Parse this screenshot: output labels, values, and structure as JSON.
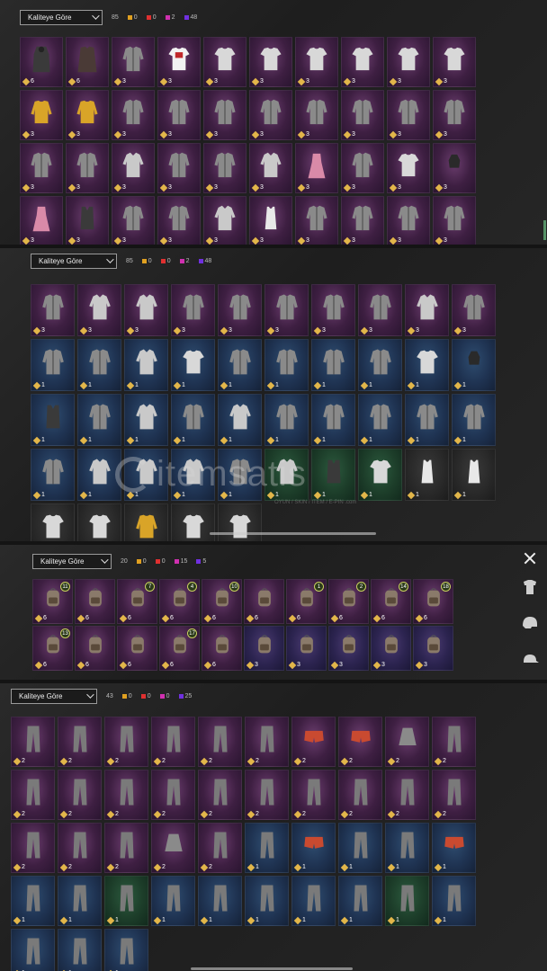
{
  "panels": [
    {
      "id": "p1",
      "sort": "Kaliteye Göre",
      "count": "85",
      "tiers": [
        "0",
        "0",
        "2",
        "48"
      ]
    },
    {
      "id": "p2",
      "sort": "Kaliteye Göre",
      "count": "85",
      "tiers": [
        "0",
        "0",
        "2",
        "48"
      ]
    },
    {
      "id": "p3",
      "sort": "Kaliteye Göre",
      "count": "20",
      "tiers": [
        "0",
        "0",
        "15",
        "5"
      ]
    },
    {
      "id": "p4",
      "sort": "Kaliteye Göre",
      "count": "43",
      "tiers": [
        "0",
        "0",
        "0",
        "25"
      ]
    }
  ],
  "colors": {
    "tier": [
      "#e0a020",
      "#e03030",
      "#d030b0",
      "#7030e0"
    ],
    "legendary": "#6b3d6e",
    "epic": "#4a3a70",
    "rare": "#2f4d70",
    "uncommon": "#2c5a3e"
  },
  "watermark": {
    "brand": "itemsatis",
    "sub": "OYUN / SKIN / İTEM / E-PIN .com"
  },
  "grids": {
    "p1": {
      "rarity": "leg",
      "rows": [
        [
          [
            "robe",
            "6"
          ],
          [
            "coat",
            "6"
          ],
          [
            "jacket",
            "3"
          ],
          [
            "tshirt-kfc",
            "3"
          ],
          [
            "tshirt",
            "3"
          ],
          [
            "tshirt",
            "3"
          ],
          [
            "tshirt",
            "3"
          ],
          [
            "tshirt",
            "3"
          ],
          [
            "tshirt",
            "3"
          ],
          [
            "tshirt",
            "3"
          ]
        ],
        [
          [
            "sweater",
            "3"
          ],
          [
            "sweater",
            "3"
          ],
          [
            "jacket",
            "3"
          ],
          [
            "jacket",
            "3"
          ],
          [
            "jacket",
            "3"
          ],
          [
            "jacket",
            "3"
          ],
          [
            "jacket",
            "3"
          ],
          [
            "jacket",
            "3"
          ],
          [
            "jacket",
            "3"
          ],
          [
            "jacket",
            "3"
          ]
        ],
        [
          [
            "jacket",
            "3"
          ],
          [
            "jacket",
            "3"
          ],
          [
            "shirt",
            "3"
          ],
          [
            "jacket",
            "3"
          ],
          [
            "jacket",
            "3"
          ],
          [
            "shirt",
            "3"
          ],
          [
            "dress",
            "3"
          ],
          [
            "jacket",
            "3"
          ],
          [
            "tshirt",
            "3"
          ],
          [
            "top",
            "3"
          ]
        ],
        [
          [
            "dress",
            "3"
          ],
          [
            "vest",
            "3"
          ],
          [
            "jacket",
            "3"
          ],
          [
            "jacket",
            "3"
          ],
          [
            "shirt",
            "3"
          ],
          [
            "tank",
            "3"
          ],
          [
            "jacket",
            "3"
          ],
          [
            "jacket",
            "3"
          ],
          [
            "jacket",
            "3"
          ],
          [
            "jacket",
            "3"
          ]
        ]
      ]
    },
    "p2": {
      "rows": [
        {
          "r": "leg",
          "items": [
            [
              "jacket",
              "3"
            ],
            [
              "shirt",
              "3"
            ],
            [
              "shirt",
              "3"
            ],
            [
              "jacket",
              "3"
            ],
            [
              "jacket",
              "3"
            ],
            [
              "jacket",
              "3"
            ],
            [
              "jacket",
              "3"
            ],
            [
              "jacket",
              "3"
            ],
            [
              "shirt",
              "3"
            ],
            [
              "jacket",
              "3"
            ]
          ]
        },
        {
          "r": "rare",
          "items": [
            [
              "jacket",
              "1"
            ],
            [
              "jacket",
              "1"
            ],
            [
              "shirt",
              "1"
            ],
            [
              "tshirt",
              "1"
            ],
            [
              "jacket",
              "1"
            ],
            [
              "jacket",
              "1"
            ],
            [
              "jacket",
              "1"
            ],
            [
              "jacket",
              "1"
            ],
            [
              "tshirt",
              "1"
            ],
            [
              "top",
              "1"
            ]
          ]
        },
        {
          "r": "rare",
          "items": [
            [
              "vest",
              "1"
            ],
            [
              "jacket",
              "1"
            ],
            [
              "shirt",
              "1"
            ],
            [
              "jacket",
              "1"
            ],
            [
              "shirt",
              "1"
            ],
            [
              "jacket",
              "1"
            ],
            [
              "jacket",
              "1"
            ],
            [
              "jacket",
              "1"
            ],
            [
              "jacket",
              "1"
            ],
            [
              "jacket",
              "1"
            ]
          ]
        },
        {
          "r": "mix",
          "items": [
            [
              "jacket",
              "1",
              "rare"
            ],
            [
              "shirt",
              "1",
              "rare"
            ],
            [
              "shirt",
              "1",
              "rare"
            ],
            [
              "shirt",
              "1",
              "rare"
            ],
            [
              "jacket",
              "1",
              "rare"
            ],
            [
              "shirt",
              "1",
              "unc"
            ],
            [
              "vest",
              "1",
              "unc"
            ],
            [
              "tshirt",
              "1",
              "unc"
            ],
            [
              "tank",
              "1",
              "com"
            ],
            [
              "tank",
              "1",
              "com"
            ]
          ]
        },
        {
          "r": "com",
          "items": [
            [
              "tshirt",
              ""
            ],
            [
              "tshirt",
              ""
            ],
            [
              "sweater",
              ""
            ],
            [
              "tshirt",
              ""
            ],
            [
              "tshirt",
              ""
            ]
          ]
        }
      ]
    },
    "p3": {
      "rows": [
        {
          "r": "leg",
          "items": [
            [
              "bag",
              "6",
              "11"
            ],
            [
              "bag",
              "6",
              ""
            ],
            [
              "bag",
              "6",
              "7"
            ],
            [
              "bag",
              "6",
              "4"
            ],
            [
              "bag",
              "6",
              "10"
            ],
            [
              "bag",
              "6",
              ""
            ],
            [
              "bag",
              "6",
              "1"
            ],
            [
              "bag",
              "6",
              "2"
            ],
            [
              "bag",
              "6",
              "14"
            ],
            [
              "bag",
              "6",
              "18"
            ]
          ]
        },
        {
          "r": "leg2",
          "items": [
            [
              "bag",
              "6",
              "13"
            ],
            [
              "bag",
              "6",
              ""
            ],
            [
              "bag",
              "6",
              ""
            ],
            [
              "bag",
              "6",
              "17"
            ],
            [
              "bag",
              "6",
              ""
            ],
            [
              "bag",
              "3",
              ""
            ],
            [
              "bag",
              "3",
              ""
            ],
            [
              "bag",
              "3",
              ""
            ],
            [
              "bag",
              "3",
              ""
            ],
            [
              "bag",
              "3",
              ""
            ]
          ]
        }
      ]
    },
    "p4": {
      "rows": [
        {
          "r": "leg",
          "items": [
            [
              "pants",
              "2"
            ],
            [
              "pants",
              "2"
            ],
            [
              "pants",
              "2"
            ],
            [
              "pants",
              "2"
            ],
            [
              "pants",
              "2"
            ],
            [
              "pants",
              "2"
            ],
            [
              "shorts",
              "2"
            ],
            [
              "shorts",
              "2"
            ],
            [
              "skirt",
              "2"
            ],
            [
              "pants",
              "2"
            ]
          ]
        },
        {
          "r": "leg",
          "items": [
            [
              "pants",
              "2"
            ],
            [
              "pants",
              "2"
            ],
            [
              "pants",
              "2"
            ],
            [
              "pants",
              "2"
            ],
            [
              "pants",
              "2"
            ],
            [
              "pants",
              "2"
            ],
            [
              "pants",
              "2"
            ],
            [
              "pants",
              "2"
            ],
            [
              "pants",
              "2"
            ],
            [
              "pants",
              "2"
            ]
          ]
        },
        {
          "r": "mix",
          "items": [
            [
              "pants",
              "2",
              "leg"
            ],
            [
              "pants",
              "2",
              "leg"
            ],
            [
              "pants",
              "2",
              "leg"
            ],
            [
              "skirt",
              "2",
              "leg"
            ],
            [
              "pants",
              "2",
              "leg"
            ],
            [
              "pants",
              "1",
              "rare"
            ],
            [
              "shorts",
              "1",
              "rare"
            ],
            [
              "pants",
              "1",
              "rare"
            ],
            [
              "pants",
              "1",
              "rare"
            ],
            [
              "shorts",
              "1",
              "rare"
            ]
          ]
        },
        {
          "r": "mix",
          "items": [
            [
              "pants",
              "1",
              "rare"
            ],
            [
              "pants",
              "1",
              "rare"
            ],
            [
              "pants",
              "1",
              "unc"
            ],
            [
              "pants",
              "1",
              "rare"
            ],
            [
              "pants",
              "1",
              "rare"
            ],
            [
              "pants",
              "1",
              "rare"
            ],
            [
              "pants",
              "1",
              "rare"
            ],
            [
              "pants",
              "1",
              "rare"
            ],
            [
              "pants",
              "1",
              "unc"
            ],
            [
              "pants",
              "1",
              "rare"
            ]
          ]
        },
        {
          "r": "rare",
          "items": [
            [
              "pants",
              "1"
            ],
            [
              "pants",
              "1"
            ],
            [
              "pants",
              "1"
            ]
          ]
        }
      ]
    }
  }
}
